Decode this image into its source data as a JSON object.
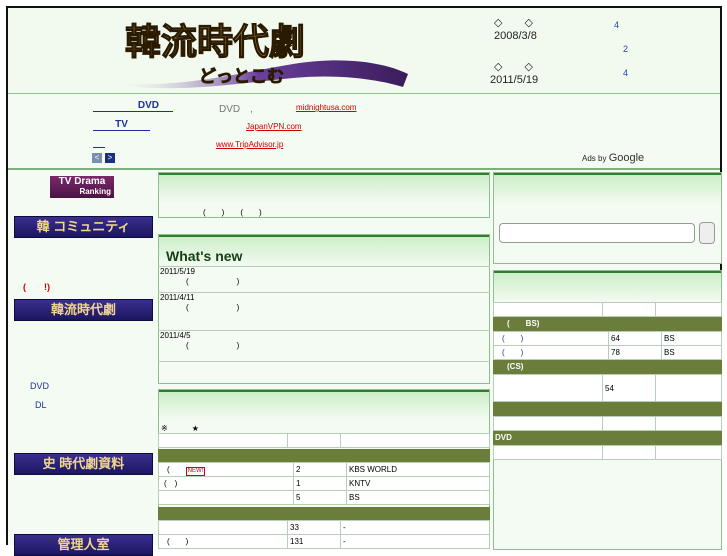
{
  "header": {
    "dates": [
      {
        "diamonds": "◇　　◇",
        "date": "2008/3/8",
        "count": "4",
        "count2": "2"
      },
      {
        "diamonds": "◇　　◇",
        "date": "2011/5/19",
        "count": "4"
      }
    ]
  },
  "ads": {
    "links": [
      "DVD",
      "TV",
      ""
    ],
    "dvd_text": "DVD　,",
    "sites": [
      "midnightusa.com",
      "JapanVPN.com",
      "www.TripAdvisor.jp"
    ],
    "prev": "<",
    "next": ">",
    "ads_by": "Ads by",
    "google": "Google"
  },
  "left": {
    "tv_drama_1": "TV Drama",
    "tv_drama_2": "Ranking",
    "banners": [
      "韓 コミュニティ",
      "韓流時代劇",
      "史 時代劇資料",
      "管理人室"
    ],
    "red_note": "(　　!)",
    "links": [
      "DVD",
      "DL"
    ]
  },
  "middle": {
    "top_row": "(　　)　　(　　)",
    "whats_new": "What's new",
    "news": [
      {
        "date": "2011/5/19",
        "text": "(　　　　　　)"
      },
      {
        "date": "2011/4/11",
        "text": "(　　　　　　)"
      },
      {
        "date": "2011/4/5",
        "text": "(　　　　　　)"
      }
    ],
    "note": "※　　　★",
    "new_badge": "NEW!",
    "table_rows": [
      {
        "a": "(　　",
        "b": "2",
        "c": "KBS WORLD",
        "badge": true
      },
      {
        "a": "(　)",
        "b": "1",
        "c": "KNTV",
        "badge": false
      },
      {
        "a": "",
        "b": "5",
        "c": "BS",
        "badge": false
      }
    ],
    "table_rows2": [
      {
        "a": "",
        "b": "33",
        "c": "-"
      },
      {
        "a": "(　　)",
        "b": "131",
        "c": "-"
      }
    ]
  },
  "right": {
    "bars": [
      "(　　BS)",
      "(CS)",
      "",
      "DVD"
    ],
    "rows_bs": [
      {
        "a": "(　　)",
        "b": "64",
        "c": "BS"
      },
      {
        "a": "(　　)",
        "b": "78",
        "c": "BS"
      }
    ],
    "row_cs": {
      "a": "",
      "b": "54",
      "c": ""
    }
  }
}
